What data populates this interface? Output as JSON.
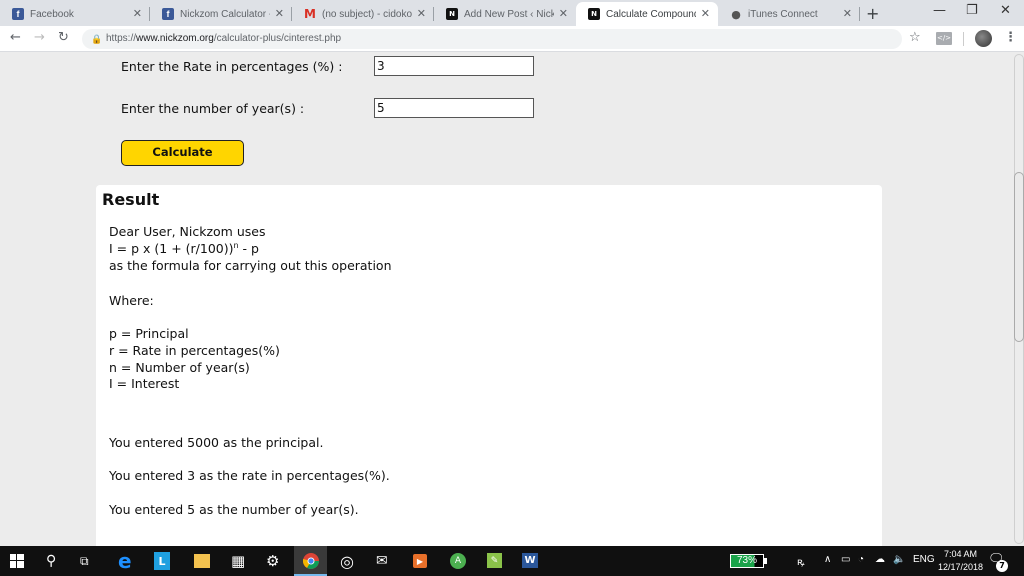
{
  "browser": {
    "tabs": [
      {
        "title": "Facebook",
        "icon": "facebook-icon",
        "active": false
      },
      {
        "title": "Nickzom Calculator - Ho",
        "icon": "facebook-icon",
        "active": false
      },
      {
        "title": "(no subject) - cidokonic",
        "icon": "gmail-icon",
        "active": false
      },
      {
        "title": "Add New Post ‹ Nickzom",
        "icon": "nickzom-icon",
        "active": false
      },
      {
        "title": "Calculate Compound In",
        "icon": "nickzom-icon",
        "active": true
      },
      {
        "title": "iTunes Connect",
        "icon": "apple-icon",
        "active": false
      }
    ],
    "new_tab": "+",
    "window_controls": {
      "minimize": "—",
      "restore": "❐",
      "close": "✕"
    },
    "url": {
      "scheme": "https://",
      "domain": "www.nickzom.org",
      "path": "/calculator-plus/cinterest.php"
    }
  },
  "form": {
    "rate_label": "Enter the Rate in percentages (%) :",
    "rate_value": "3",
    "years_label": "Enter the number of year(s) :",
    "years_value": "5",
    "calculate_label": "Calculate"
  },
  "result": {
    "title": "Result",
    "intro": "Dear User, Nickzom uses",
    "formula_prefix": "I = p x (1 + (r/100))",
    "formula_exp": "n",
    "formula_suffix": " - p",
    "formula_note": "as the formula for carrying out this operation",
    "where": "Where:",
    "definitions": [
      "p = Principal",
      "r = Rate in percentages(%)",
      "n = Number of year(s)",
      "I = Interest"
    ],
    "entered": [
      "You entered 5000 as the principal.",
      "You entered 3 as the rate in percentages(%).",
      "You entered 5 as the number of year(s)."
    ]
  },
  "taskbar": {
    "battery_percent": "73%",
    "language": "ENG",
    "time": "7:04 AM",
    "date": "12/17/2018",
    "notifications": "7"
  }
}
